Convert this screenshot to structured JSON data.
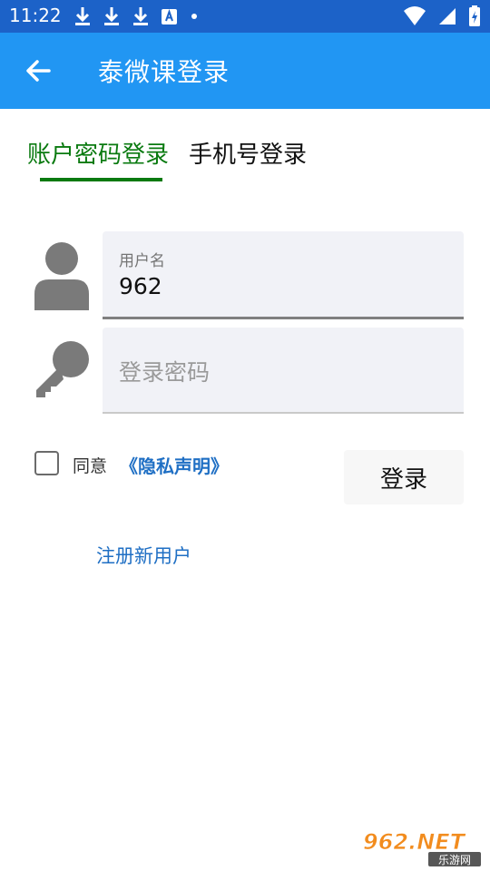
{
  "status_bar": {
    "time": "11:22"
  },
  "app_bar": {
    "title": "泰微课登录"
  },
  "tabs": [
    {
      "label": "账户密码登录",
      "active": true
    },
    {
      "label": "手机号登录",
      "active": false
    }
  ],
  "username": {
    "label": "用户名",
    "value": "962"
  },
  "password": {
    "placeholder": "登录密码"
  },
  "agreement": {
    "checked": false,
    "label": "同意",
    "link": "《隐私声明》"
  },
  "login_button": {
    "label": "登录"
  },
  "register_link": "注册新用户",
  "watermark": {
    "top": "962.NET",
    "bottom": "乐游网"
  },
  "colors": {
    "status_bar": "#1c62c8",
    "app_bar": "#2196f3",
    "active_tab": "#0a7a10",
    "link": "#1f6fc4"
  }
}
